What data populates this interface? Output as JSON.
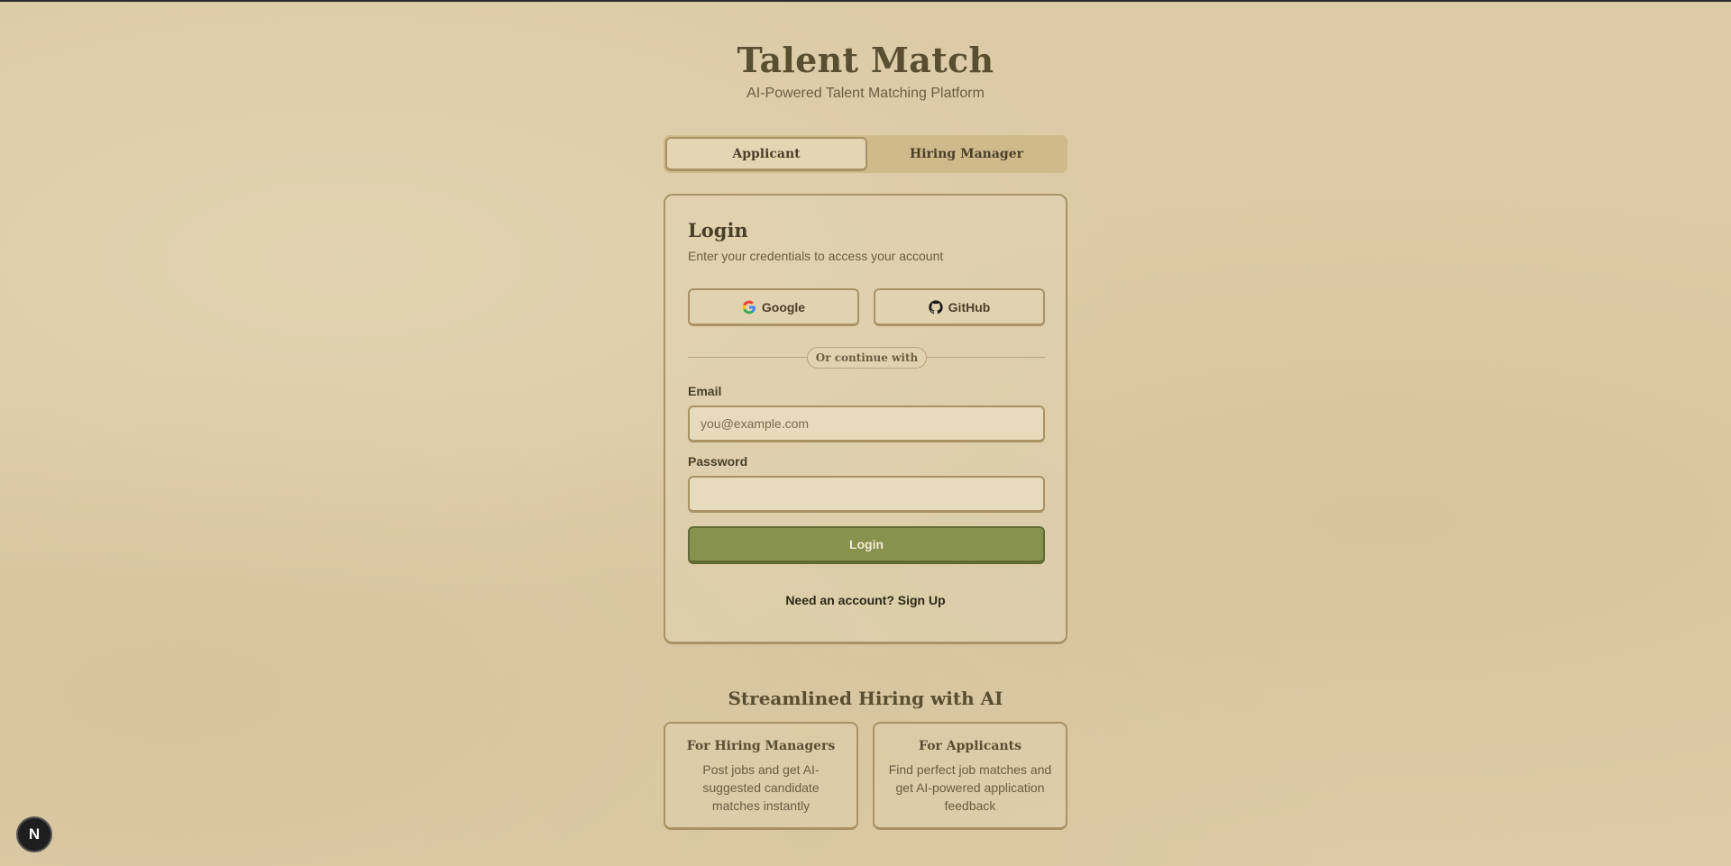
{
  "header": {
    "title": "Talent Match",
    "subtitle": "AI-Powered Talent Matching Platform"
  },
  "tabs": [
    {
      "label": "Applicant",
      "active": true
    },
    {
      "label": "Hiring Manager",
      "active": false
    }
  ],
  "login": {
    "title": "Login",
    "description": "Enter your credentials to access your account",
    "google_label": "Google",
    "github_label": "GitHub",
    "divider_text": "Or continue with",
    "email_label": "Email",
    "email_placeholder": "you@example.com",
    "email_value": "",
    "password_label": "Password",
    "password_value": "",
    "submit_label": "Login",
    "signup_text": "Need an account? Sign Up"
  },
  "features": {
    "title": "Streamlined Hiring with AI",
    "items": [
      {
        "title": "For Hiring Managers",
        "description": "Post jobs and get AI-suggested candidate matches instantly"
      },
      {
        "title": "For Applicants",
        "description": "Find perfect job matches and get AI-powered application feedback"
      }
    ]
  },
  "badge": {
    "letter": "N"
  },
  "colors": {
    "background": "#dccba6",
    "primary_button": "#87924f",
    "border": "#a89266",
    "text": "#4a3f28"
  }
}
